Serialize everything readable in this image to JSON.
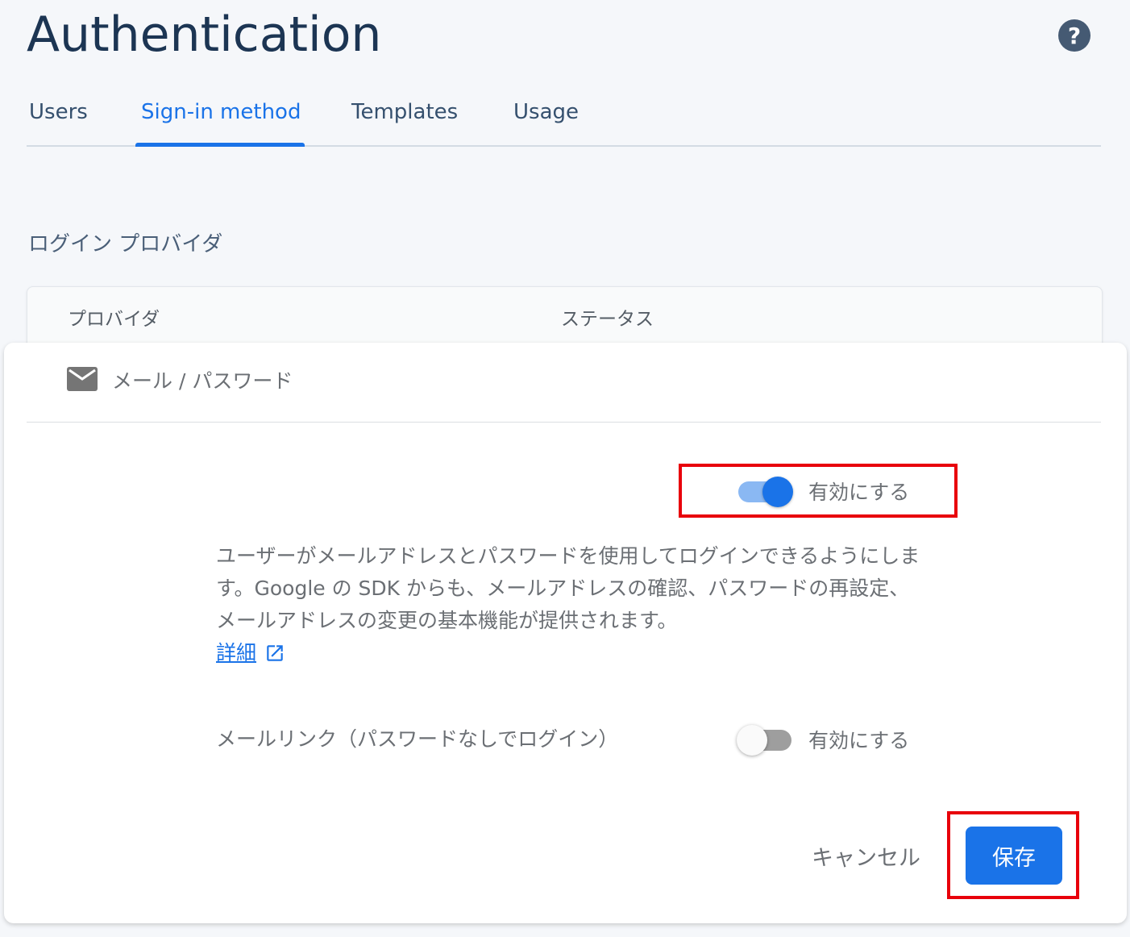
{
  "header": {
    "title": "Authentication",
    "help_icon": "help-circle-icon",
    "help_glyph": "?"
  },
  "tabs": [
    {
      "label": "Users",
      "active": false
    },
    {
      "label": "Sign-in method",
      "active": true
    },
    {
      "label": "Templates",
      "active": false
    },
    {
      "label": "Usage",
      "active": false
    }
  ],
  "section": {
    "title": "ログイン プロバイダ"
  },
  "table": {
    "headers": [
      "プロバイダ",
      "ステータス"
    ]
  },
  "provider_panel": {
    "provider_icon": "mail-icon",
    "provider_name": "メール / パスワード",
    "email_password_toggle": {
      "label": "有効にする",
      "enabled": true
    },
    "description": "ユーザーがメールアドレスとパスワードを使用してログインできるようにします。Google の SDK からも、メールアドレスの確認、パスワードの再設定、メールアドレスの変更の基本機能が提供されます。",
    "details_link": "詳細",
    "details_link_icon": "open-in-new-icon",
    "email_link": {
      "label": "メールリンク（パスワードなしでログイン）",
      "toggle_label": "有効にする",
      "enabled": false
    },
    "cancel_label": "キャンセル",
    "save_label": "保存"
  },
  "colors": {
    "accent": "#1a73e8",
    "highlight": "#e8000b",
    "title": "#1c3553"
  }
}
